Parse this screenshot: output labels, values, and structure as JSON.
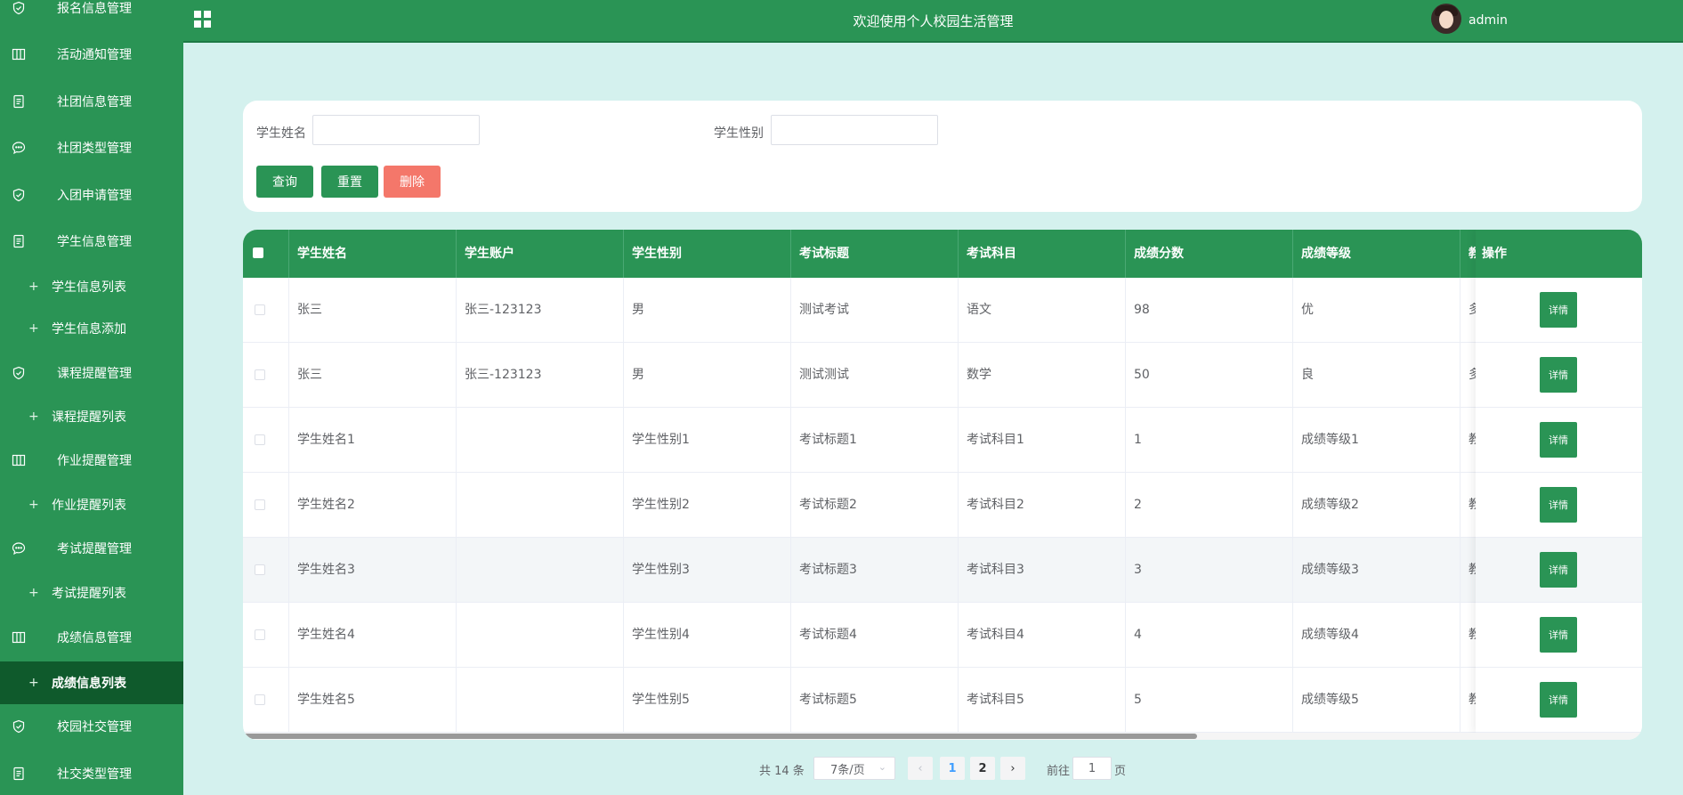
{
  "header": {
    "title": "欢迎使用个人校园生活管理",
    "username": "admin"
  },
  "sidebar": {
    "items": [
      {
        "label": "报名信息管理",
        "type": "group",
        "icon": "shield-check-icon"
      },
      {
        "label": "活动通知管理",
        "type": "group",
        "icon": "columns-icon"
      },
      {
        "label": "社团信息管理",
        "type": "group",
        "icon": "document-icon"
      },
      {
        "label": "社团类型管理",
        "type": "group",
        "icon": "chat-bubble-icon"
      },
      {
        "label": "入团申请管理",
        "type": "group",
        "icon": "shield-check-icon"
      },
      {
        "label": "学生信息管理",
        "type": "group",
        "icon": "document-icon"
      },
      {
        "label": "学生信息列表",
        "type": "sub"
      },
      {
        "label": "学生信息添加",
        "type": "sub"
      },
      {
        "label": "课程提醒管理",
        "type": "group",
        "icon": "shield-check-icon"
      },
      {
        "label": "课程提醒列表",
        "type": "sub"
      },
      {
        "label": "作业提醒管理",
        "type": "group",
        "icon": "columns-icon"
      },
      {
        "label": "作业提醒列表",
        "type": "sub"
      },
      {
        "label": "考试提醒管理",
        "type": "group",
        "icon": "chat-bubble-icon"
      },
      {
        "label": "考试提醒列表",
        "type": "sub"
      },
      {
        "label": "成绩信息管理",
        "type": "group",
        "icon": "columns-icon"
      },
      {
        "label": "成绩信息列表",
        "type": "sub",
        "active": true
      },
      {
        "label": "校园社交管理",
        "type": "group",
        "icon": "shield-check-icon"
      },
      {
        "label": "社交类型管理",
        "type": "group",
        "icon": "document-icon"
      }
    ]
  },
  "search": {
    "name_label": "学生姓名",
    "name_value": "",
    "gender_label": "学生性别",
    "gender_value": "",
    "query_label": "查询",
    "reset_label": "重置",
    "delete_label": "删除"
  },
  "table": {
    "columns": [
      "学生姓名",
      "学生账户",
      "学生性别",
      "考试标题",
      "考试科目",
      "成绩分数",
      "成绩等级",
      "教",
      "操作"
    ],
    "detail_label": "详情",
    "rows": [
      [
        "张三",
        "张三-123123",
        "男",
        "测试考试",
        "语文",
        "98",
        "优",
        "多"
      ],
      [
        "张三",
        "张三-123123",
        "男",
        "测试测试",
        "数学",
        "50",
        "良",
        "多"
      ],
      [
        "学生姓名1",
        "",
        "学生性别1",
        "考试标题1",
        "考试科目1",
        "1",
        "成绩等级1",
        "教"
      ],
      [
        "学生姓名2",
        "",
        "学生性别2",
        "考试标题2",
        "考试科目2",
        "2",
        "成绩等级2",
        "教"
      ],
      [
        "学生姓名3",
        "",
        "学生性别3",
        "考试标题3",
        "考试科目3",
        "3",
        "成绩等级3",
        "教"
      ],
      [
        "学生姓名4",
        "",
        "学生性别4",
        "考试标题4",
        "考试科目4",
        "4",
        "成绩等级4",
        "教"
      ],
      [
        "学生姓名5",
        "",
        "学生性别5",
        "考试标题5",
        "考试科目5",
        "5",
        "成绩等级5",
        "教"
      ]
    ]
  },
  "pagination": {
    "total_text": "共 14 条",
    "page_size": "7条/页",
    "pages": [
      "1",
      "2"
    ],
    "current": "1",
    "goto_prefix": "前往",
    "goto_value": "1",
    "goto_suffix": "页"
  }
}
